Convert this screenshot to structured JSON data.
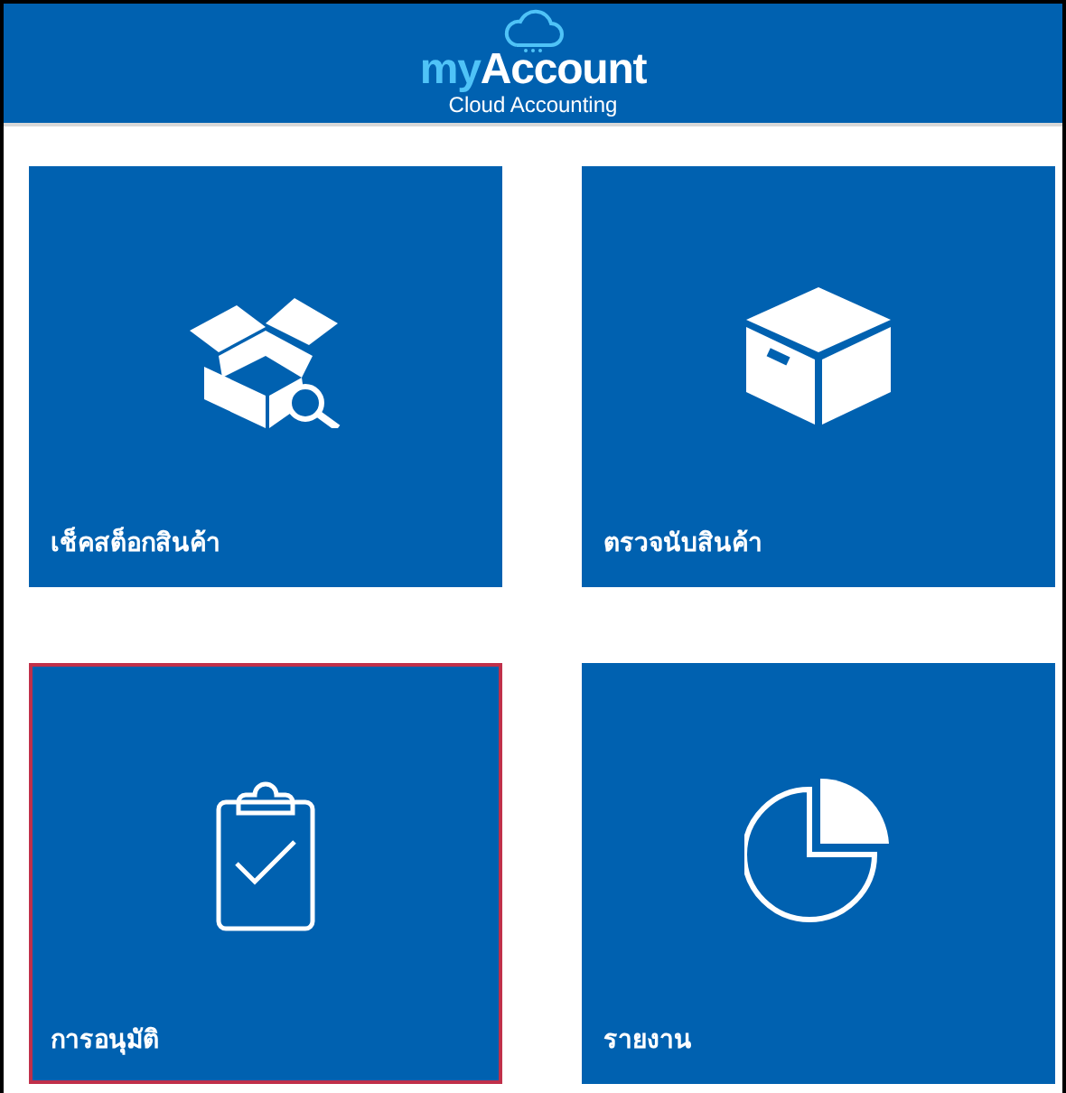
{
  "header": {
    "brand_prefix": "my",
    "brand_name": "Account",
    "tagline": "Cloud Accounting"
  },
  "tiles": [
    {
      "label": "เช็คสต็อกสินค้า",
      "kind": "open-box",
      "selected": false
    },
    {
      "label": "ตรวจนับสินค้า",
      "kind": "box",
      "selected": false
    },
    {
      "label": "การอนุมัติ",
      "kind": "clipboard",
      "selected": true
    },
    {
      "label": "รายงาน",
      "kind": "pie",
      "selected": false
    }
  ]
}
